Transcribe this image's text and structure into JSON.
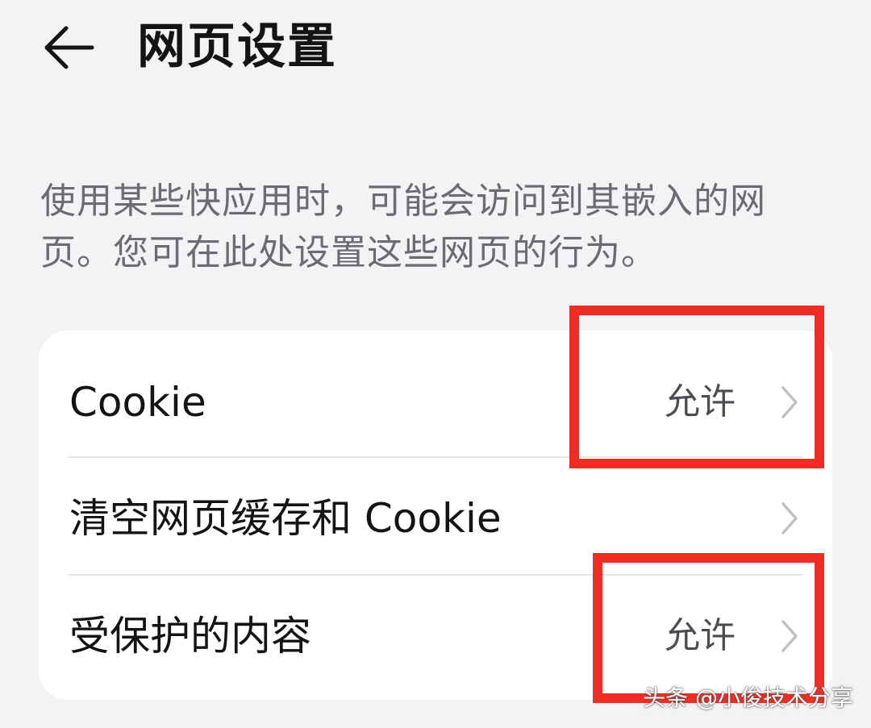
{
  "header": {
    "back_icon": "arrow-left-icon",
    "title": "网页设置"
  },
  "description": "使用某些快应用时，可能会访问到其嵌入的网页。您可在此处设置这些网页的行为。",
  "settings": {
    "items": [
      {
        "label": "Cookie",
        "value": "允许",
        "icon": "chevron-right-icon"
      },
      {
        "label": "清空网页缓存和 Cookie",
        "value": "",
        "icon": "chevron-right-icon"
      },
      {
        "label": "受保护的内容",
        "value": "允许",
        "icon": "chevron-right-icon"
      }
    ]
  },
  "annotations": {
    "highlight_color": "#f02d24"
  },
  "watermark": "头条 @小俊技术分享",
  "colors": {
    "background": "#f1f3f5",
    "card": "#ffffff",
    "title_text": "#141414",
    "description_text": "#6a6c70",
    "value_text": "#4b4d52",
    "chevron": "#bfc1c5"
  }
}
